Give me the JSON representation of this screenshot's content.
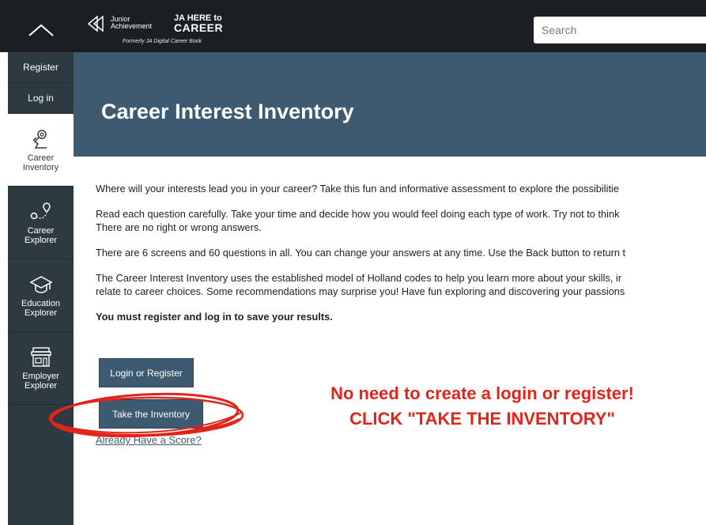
{
  "header": {
    "logo": {
      "ja_text": "Junior Achievement",
      "here_text": "JA HERE to",
      "career_text": "CAREER",
      "formerly_text": "Formerly JA Digital Career Book"
    },
    "search_placeholder": "Search"
  },
  "sidebar": {
    "register": "Register",
    "login": "Log in",
    "items": [
      {
        "label_lines": [
          "Career",
          "Inventory"
        ],
        "icon": "career-inventory-icon",
        "active": true
      },
      {
        "label_lines": [
          "Career",
          "Explorer"
        ],
        "icon": "career-explorer-icon",
        "active": false
      },
      {
        "label_lines": [
          "Education",
          "Explorer"
        ],
        "icon": "education-explorer-icon",
        "active": false
      },
      {
        "label_lines": [
          "Employer",
          "Explorer"
        ],
        "icon": "employer-explorer-icon",
        "active": false
      }
    ]
  },
  "page": {
    "title": "Career Interest Inventory",
    "paragraphs": [
      "Where will your interests lead you in your career? Take this fun and informative assessment to explore the possibilitie",
      "Read each question carefully. Take your time and decide how you would feel doing each type of work. Try not to think",
      "There are no right or wrong answers.",
      "There are 6 screens and 60 questions in all. You can change your answers at any time. Use the Back button to return t",
      "The Career Interest Inventory uses the established model of Holland codes to help you learn more about your skills, ir",
      "relate to career choices. Some recommendations may surprise you! Have fun exploring and discovering your passions"
    ],
    "must_register": "You must register and log in to save your results.",
    "login_button": "Login or Register",
    "take_button": "Take the Inventory",
    "score_link": "Already Have a Score?"
  },
  "annotation": {
    "line1": "No need to create a login or register!",
    "line2": "CLICK \"TAKE THE INVENTORY\"",
    "color": "#e1251b"
  },
  "colors": {
    "topbar": "#1b1f24",
    "sidebar": "#2d3a42",
    "banner": "#3e5a70"
  }
}
